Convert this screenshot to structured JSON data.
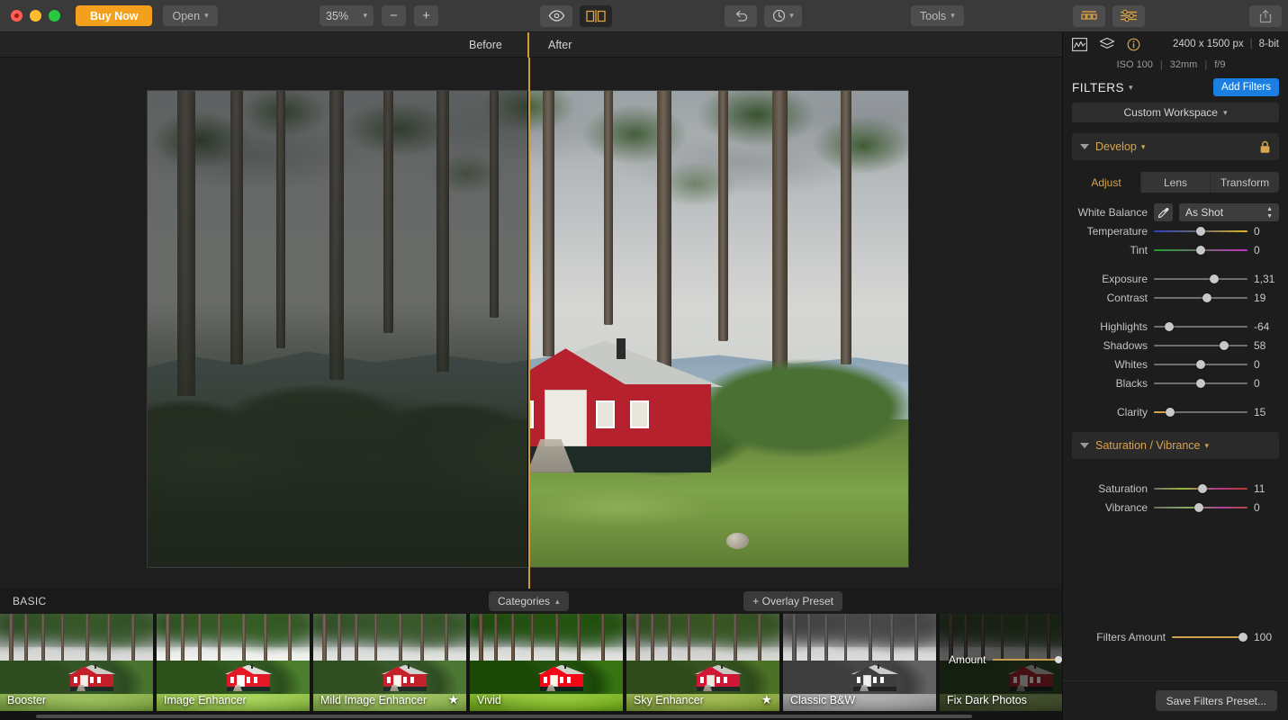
{
  "toolbar": {
    "buy_now_label": "Buy Now",
    "open_label": "Open",
    "zoom_level": "35%",
    "zoom_out_label": "−",
    "zoom_in_label": "+",
    "eye_icon": "eye-icon",
    "compare_icon": "split-compare-icon",
    "undo_icon": "undo-icon",
    "history_icon": "history-clock-icon",
    "tools_label": "Tools",
    "presets_icon": "presets-icon",
    "adjust_icon": "sliders-icon",
    "export_icon": "share-export-icon",
    "accent_color": "#f5a01c"
  },
  "compare_bar": {
    "before_label": "Before",
    "after_label": "After",
    "divider_color": "#cf9b3b"
  },
  "info": {
    "histogram_icon": "histogram-icon",
    "layers_icon": "layers-icon",
    "info_icon": "info-circle-icon",
    "dimensions": "2400 x 1500 px",
    "bit_depth": "8-bit",
    "iso": "ISO 100",
    "focal_length": "32mm",
    "aperture": "f/9"
  },
  "filters_panel": {
    "title": "FILTERS",
    "add_filters_label": "Add Filters",
    "workspace_label": "Custom Workspace",
    "accent_color": "#d8a44e",
    "add_button_color": "#1a7fe0"
  },
  "develop": {
    "section_label": "Develop",
    "lock_icon": "lock-icon",
    "tabs": [
      {
        "label": "Adjust",
        "active": true
      },
      {
        "label": "Lens",
        "active": false
      },
      {
        "label": "Transform",
        "active": false
      }
    ],
    "white_balance": {
      "label": "White Balance",
      "eyedropper_icon": "eyedropper-icon",
      "value": "As Shot"
    },
    "sliders": [
      {
        "name": "Temperature",
        "value": "0",
        "pos": 50,
        "rail": "temp",
        "fill": 0
      },
      {
        "name": "Tint",
        "value": "0",
        "pos": 50,
        "rail": "tint",
        "fill": 0
      },
      {
        "name": "Exposure",
        "value": "1,31",
        "pos": 66,
        "rail": "plain",
        "fill": 0
      },
      {
        "name": "Contrast",
        "value": "19",
        "pos": 57,
        "rail": "plain",
        "fill": 0
      },
      {
        "name": "Highlights",
        "value": "-64",
        "pos": 13,
        "rail": "plain",
        "fill": 0
      },
      {
        "name": "Shadows",
        "value": "58",
        "pos": 78,
        "rail": "plain",
        "fill": 0
      },
      {
        "name": "Whites",
        "value": "0",
        "pos": 50,
        "rail": "plain",
        "fill": 0
      },
      {
        "name": "Blacks",
        "value": "0",
        "pos": 50,
        "rail": "plain",
        "fill": 0
      },
      {
        "name": "Clarity",
        "value": "15",
        "pos": 14,
        "rail": "plain",
        "fill": 14
      }
    ]
  },
  "saturation_vibrance": {
    "section_label": "Saturation / Vibrance",
    "sliders": [
      {
        "name": "Saturation",
        "value": "11",
        "pos": 52,
        "rail": "sat",
        "fill": 0
      },
      {
        "name": "Vibrance",
        "value": "0",
        "pos": 48,
        "rail": "vib",
        "fill": 0
      }
    ]
  },
  "filters_amount": {
    "name": "Filters Amount",
    "value": "100",
    "pos": 100
  },
  "panel_footer": {
    "save_preset_label": "Save Filters Preset..."
  },
  "filmstrip": {
    "category_title": "BASIC",
    "categories_label": "Categories",
    "overlay_preset_label": "+ Overlay Preset",
    "presets": [
      {
        "label": "Booster",
        "starred": false,
        "selected": false,
        "style": "boost"
      },
      {
        "label": "Image Enhancer",
        "starred": false,
        "selected": false,
        "style": "enh"
      },
      {
        "label": "Mild Image Enhancer",
        "starred": true,
        "selected": false,
        "style": "mild"
      },
      {
        "label": "Vivid",
        "starred": false,
        "selected": false,
        "style": "vivid"
      },
      {
        "label": "Sky Enhancer",
        "starred": true,
        "selected": false,
        "style": "sky"
      },
      {
        "label": "Classic B&W",
        "starred": false,
        "selected": false,
        "style": "bw"
      },
      {
        "label": "Fix Dark Photos",
        "starred": true,
        "selected": true,
        "style": "dark",
        "amount_label": "Amount",
        "amount_value": "100"
      }
    ]
  }
}
